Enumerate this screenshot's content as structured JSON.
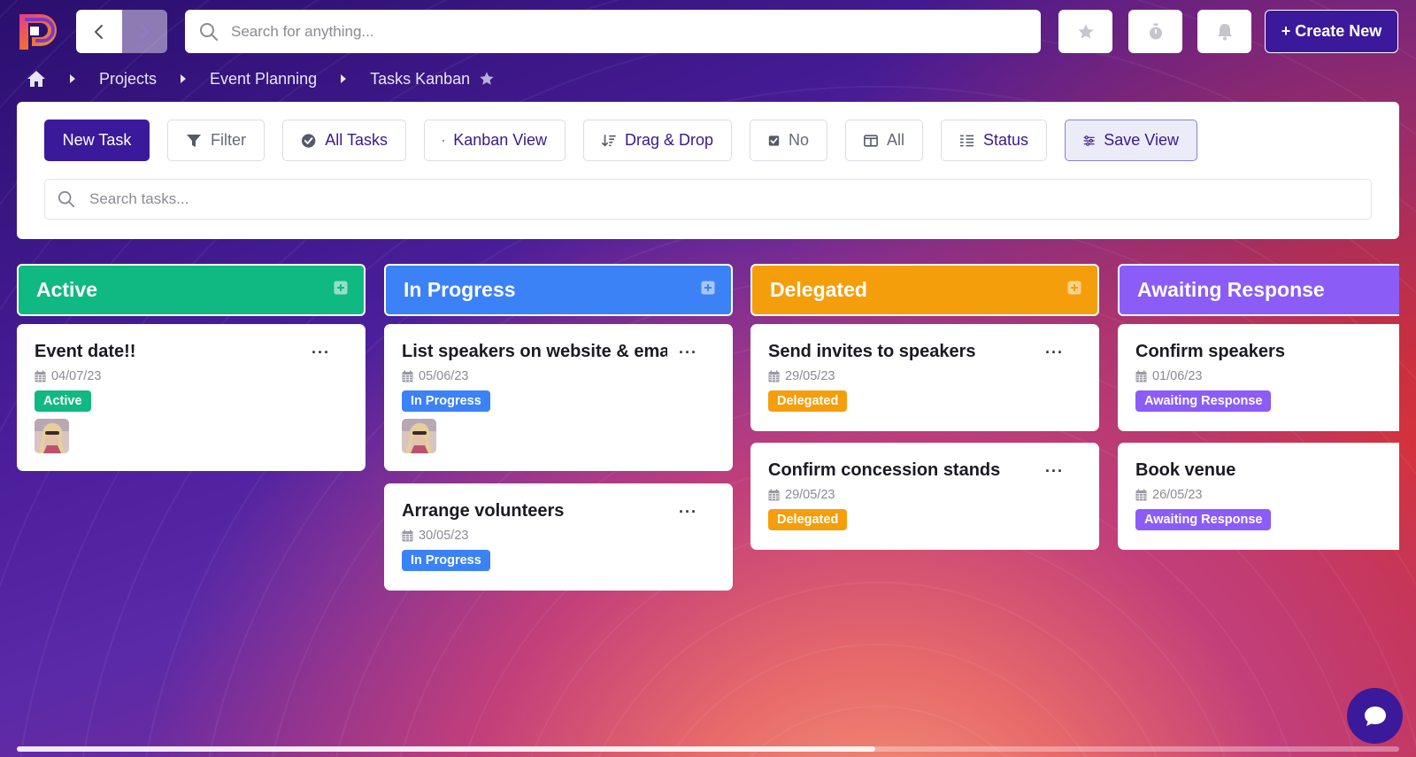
{
  "topbar": {
    "search_placeholder": "Search for anything...",
    "create_label": "+ Create New"
  },
  "breadcrumb": {
    "items": [
      "Projects",
      "Event Planning",
      "Tasks Kanban"
    ]
  },
  "toolbar": {
    "new_task": "New Task",
    "filter": "Filter",
    "all_tasks": "All Tasks",
    "kanban_view": "Kanban View",
    "drag_drop": "Drag & Drop",
    "no": "No",
    "all": "All",
    "status": "Status",
    "save_view": "Save View",
    "search_placeholder": "Search tasks..."
  },
  "columns": [
    {
      "title": "Active",
      "color": "#10b981",
      "cards": [
        {
          "title": "Event date!!",
          "date": "04/07/23",
          "badge": "Active",
          "has_avatar": true
        }
      ]
    },
    {
      "title": "In Progress",
      "color": "#3b82f6",
      "cards": [
        {
          "title": "List speakers on website & ema",
          "date": "05/06/23",
          "badge": "In Progress",
          "has_avatar": true
        },
        {
          "title": "Arrange volunteers",
          "date": "30/05/23",
          "badge": "In Progress",
          "has_avatar": false
        }
      ]
    },
    {
      "title": "Delegated",
      "color": "#f59e0b",
      "cards": [
        {
          "title": "Send invites to speakers",
          "date": "29/05/23",
          "badge": "Delegated",
          "has_avatar": false
        },
        {
          "title": "Confirm concession stands",
          "date": "29/05/23",
          "badge": "Delegated",
          "has_avatar": false
        }
      ]
    },
    {
      "title": "Awaiting Response",
      "color": "#8b5cf6",
      "cards": [
        {
          "title": "Confirm speakers",
          "date": "01/06/23",
          "badge": "Awaiting Response",
          "has_avatar": false
        },
        {
          "title": "Book venue",
          "date": "26/05/23",
          "badge": "Awaiting Response",
          "has_avatar": false
        }
      ]
    }
  ],
  "card_menu": "···",
  "colors": {
    "accent": "#3a1a9a",
    "active": "#10b981",
    "in_progress": "#3b82f6",
    "delegated": "#f59e0b",
    "awaiting": "#8b5cf6"
  }
}
